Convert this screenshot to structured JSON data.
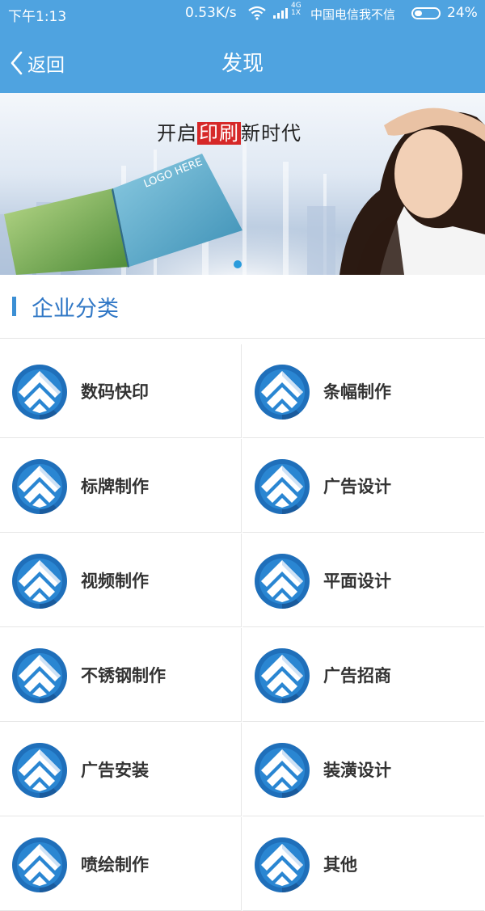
{
  "status_bar": {
    "time": "下午1:13",
    "speed": "0.53K/s",
    "network_top": "4G",
    "network_bottom": "1X",
    "carrier": "中国电信我不信",
    "battery": "24%",
    "battery_level": 0.24
  },
  "nav": {
    "back_label": "返回",
    "title": "发现"
  },
  "banner": {
    "slogan_before": "开启",
    "slogan_highlight": "印刷",
    "slogan_after": "新时代",
    "book_text": "LOGO HERE",
    "slide_count": 1,
    "active_slide": 1
  },
  "section": {
    "title": "企业分类"
  },
  "categories": [
    {
      "label": "数码快印"
    },
    {
      "label": "条幅制作"
    },
    {
      "label": "标牌制作"
    },
    {
      "label": "广告设计"
    },
    {
      "label": "视频制作"
    },
    {
      "label": "平面设计"
    },
    {
      "label": "不锈钢制作"
    },
    {
      "label": "广告招商"
    },
    {
      "label": "广告安装"
    },
    {
      "label": "装潢设计"
    },
    {
      "label": "喷绘制作"
    },
    {
      "label": "其他"
    }
  ],
  "colors": {
    "header_blue": "#4fa3e0",
    "accent_blue": "#3178c6",
    "icon_blue": "#1f6fba",
    "highlight_red": "#d62828"
  }
}
